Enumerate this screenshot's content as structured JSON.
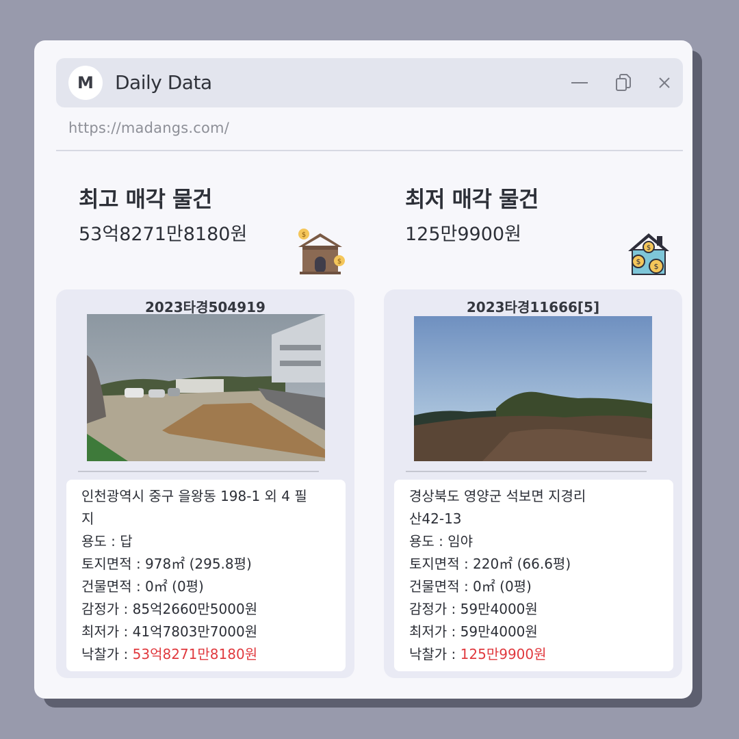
{
  "window": {
    "logo_letter": "M",
    "title": "Daily Data",
    "url": "https://madangs.com/"
  },
  "highest": {
    "heading": "최고 매각 물건",
    "amount": "53억8271만8180원",
    "icon": "house-money-icon"
  },
  "lowest": {
    "heading": "최저 매각 물건",
    "amount": "125만9900원",
    "icon": "house-coins-icon"
  },
  "cards": [
    {
      "case_no": "2023타경504919",
      "address_line1": "인천광역시 중구 을왕동 198-1 외 4 필",
      "address_line2": "지",
      "usage": "용도 : 답",
      "land_area": "토지면적 : 978㎡ (295.8평)",
      "building_area": "건물면적 : 0㎡ (0평)",
      "appraisal": "감정가 : 85억2660만5000원",
      "minimum": "최저가 : 41억7803만7000원",
      "winning_label": "낙찰가 : ",
      "winning_value": "53억8271만8180원"
    },
    {
      "case_no": "2023타경11666[5]",
      "address_line1": "경상북도 영양군 석보면 지경리",
      "address_line2": "산42-13",
      "usage": "용도 : 임야",
      "land_area": "토지면적 : 220㎡ (66.6평)",
      "building_area": "건물면적 : 0㎡ (0평)",
      "appraisal": "감정가 : 59만4000원",
      "minimum": "최저가 : 59만4000원",
      "winning_label": "낙찰가 : ",
      "winning_value": "125만9900원"
    }
  ],
  "colors": {
    "background": "#989aac",
    "window": "#f7f7fb",
    "titlebar": "#e3e5ee",
    "card": "#e9eaf4",
    "price_red": "#e0393e"
  }
}
